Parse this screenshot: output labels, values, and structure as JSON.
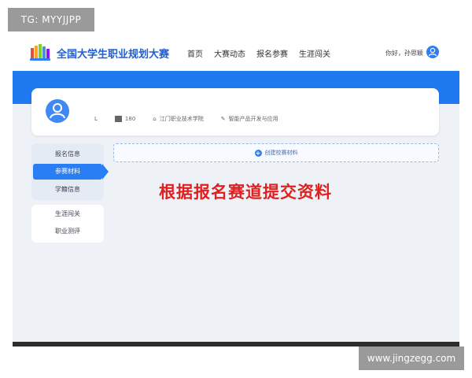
{
  "watermarks": {
    "top_left": "TG: MYYJJPP",
    "bottom_right": "www.jingzegg.com"
  },
  "header": {
    "site_title": "全国大学生职业规划大赛",
    "nav": [
      "首页",
      "大赛动态",
      "报名参赛",
      "生涯闯关"
    ],
    "greeting": "你好，孙思颖"
  },
  "profile": {
    "name_initial": "L",
    "id_fragment": "180",
    "school": "江门职业技术学院",
    "track": "智能产品开发与应用"
  },
  "sidebar": {
    "items": [
      "报名信息",
      "参赛材料",
      "学籍信息"
    ],
    "active_index": 1,
    "secondary_items": [
      "生涯闯关",
      "职业测评"
    ]
  },
  "main": {
    "create_button": "创建校赛材料",
    "annotation": "根据报名赛道提交资料"
  },
  "colors": {
    "brand_blue": "#1f7af0",
    "annotation_red": "#e02020"
  }
}
